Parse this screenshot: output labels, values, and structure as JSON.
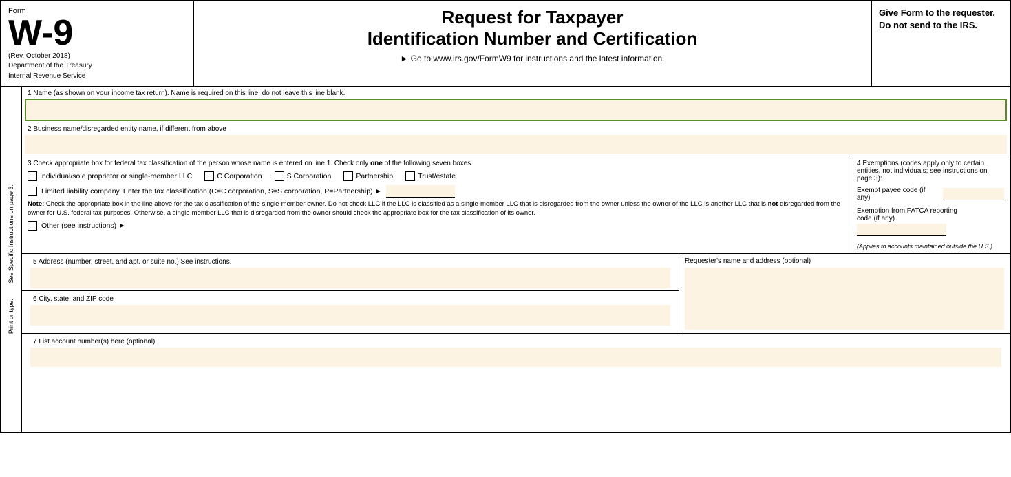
{
  "header": {
    "form_label": "Form",
    "form_number": "W-9",
    "rev_date": "(Rev. October 2018)",
    "dept_line1": "Department of the Treasury",
    "dept_line2": "Internal Revenue Service",
    "title_line1": "Request for Taxpayer",
    "title_line2": "Identification Number and Certification",
    "instruction": "► Go to www.irs.gov/FormW9 for instructions and the latest information.",
    "give_form": "Give Form to the requester. Do not send to the IRS."
  },
  "fields": {
    "field1_label": "1  Name (as shown on your income tax return). Name is required on this line; do not leave this line blank.",
    "field2_label": "2  Business name/disregarded entity name, if different from above",
    "field3_label": "3  Check appropriate box for federal tax classification of the person whose name is entered on line 1. Check only",
    "field3_label_bold": "one",
    "field3_label2": "of the following seven boxes.",
    "checkbox_individual": "Individual/sole proprietor or single-member LLC",
    "checkbox_c_corp": "C Corporation",
    "checkbox_s_corp": "S Corporation",
    "checkbox_partnership": "Partnership",
    "checkbox_trust": "Trust/estate",
    "llc_label": "Limited liability company. Enter the tax classification (C=C corporation, S=S corporation, P=Partnership) ►",
    "note_label": "Note:",
    "note_text": " Check the appropriate box in the line above for the tax classification of the single-member owner.  Do not check LLC if the LLC is classified as a single-member LLC that is disregarded from the owner unless the owner of the LLC is another LLC that is ",
    "note_bold": "not",
    "note_text2": " disregarded from the owner for U.S. federal tax purposes. Otherwise, a single-member LLC that is disregarded from the owner should check the appropriate box for the tax classification of its owner.",
    "other_label": "Other (see instructions) ►",
    "field4_label": "4  Exemptions (codes apply only to certain entities, not individuals; see instructions on page 3):",
    "exempt_payee_label": "Exempt payee code (if any)",
    "fatca_label1": "Exemption from FATCA reporting",
    "fatca_label2": "code (if any)",
    "applies_note": "(Applies to accounts maintained outside the U.S.)",
    "field5_label": "5  Address (number, street, and apt. or suite no.) See instructions.",
    "field6_label": "6  City, state, and ZIP code",
    "requester_label": "Requester's name and address (optional)",
    "field7_label": "7  List account number(s) here (optional)"
  },
  "sidebar": {
    "text": "See Specific Instructions on page 3.",
    "text2": "Print or type."
  }
}
